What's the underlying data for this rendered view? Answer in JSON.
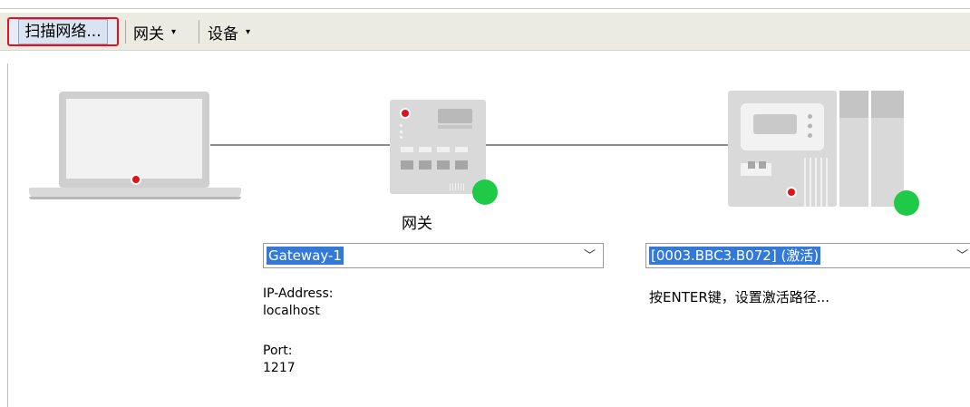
{
  "toolbar": {
    "scan_label": "扫描网络...",
    "gateway_menu": "网关",
    "device_menu": "设备",
    "caret": "▾"
  },
  "gateway": {
    "label": "网关",
    "selected": "Gateway-1",
    "ip_label": "IP-Address:",
    "ip_value": "localhost",
    "port_label": "Port:",
    "port_value": "1217"
  },
  "device": {
    "selected": "[0003.BBC3.B072] (激活)",
    "hint": "按ENTER键，设置激活路径..."
  },
  "colors": {
    "status_online": "#1fca46",
    "led_red": "#e0101c",
    "selection": "#3379d8",
    "highlight_border": "#e8101c"
  }
}
